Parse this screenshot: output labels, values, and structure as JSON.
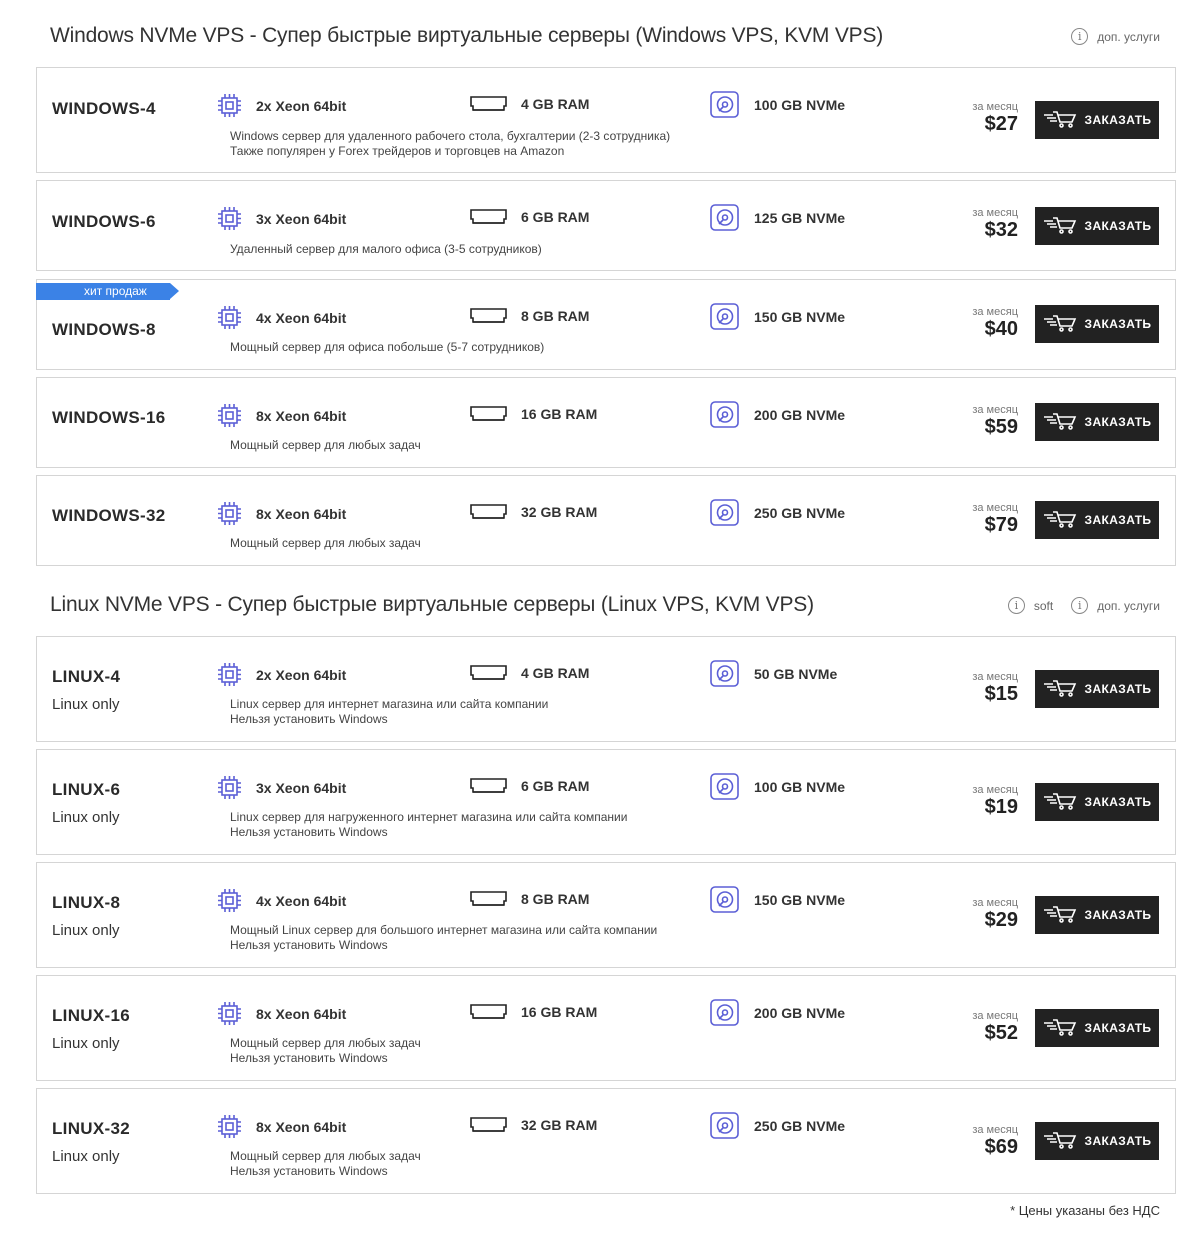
{
  "windows_section": {
    "title": "Windows NVMe VPS - Супер быстрые виртуальные серверы (Windows VPS, KVM VPS)",
    "extra_services": "доп. услуги"
  },
  "linux_section": {
    "title": "Linux NVMe VPS - Супер быстрые виртуальные серверы (Linux VPS, KVM VPS)",
    "soft": "soft",
    "extra_services": "доп. услуги"
  },
  "common": {
    "per_month": "за месяц",
    "order_label": "ЗАКАЗАТЬ",
    "bestseller": "хит продаж",
    "linux_only": "Linux only"
  },
  "colors": {
    "accent": "#5b5fd6",
    "button": "#222222",
    "badge": "#3b82e6",
    "border": "#d5d5d5"
  },
  "windows_plans": [
    {
      "name": "WINDOWS-4",
      "cpu": "2x Xeon 64bit",
      "ram": "4 GB RAM",
      "disk": "100 GB NVMe",
      "desc1": "Windows сервер для удаленного рабочего стола, бухгалтерии (2-3 сотрудника)",
      "desc2": "Также популярен у Forex трейдеров и торговцев на Amazon",
      "price": "$27"
    },
    {
      "name": "WINDOWS-6",
      "cpu": "3x Xeon 64bit",
      "ram": "6 GB RAM",
      "disk": "125 GB NVMe",
      "desc1": "Удаленный сервер для малого офиса (3-5 сотрудников)",
      "price": "$32"
    },
    {
      "name": "WINDOWS-8",
      "cpu": "4x Xeon 64bit",
      "ram": "8 GB RAM",
      "disk": "150 GB NVMe",
      "desc1": "Мощный сервер для офиса побольше (5-7 сотрудников)",
      "price": "$40"
    },
    {
      "name": "WINDOWS-16",
      "cpu": "8x Xeon 64bit",
      "ram": "16 GB RAM",
      "disk": "200 GB NVMe",
      "desc1": "Мощный сервер для любых задач",
      "price": "$59"
    },
    {
      "name": "WINDOWS-32",
      "cpu": "8x Xeon 64bit",
      "ram": "32 GB RAM",
      "disk": "250 GB NVMe",
      "desc1": "Мощный сервер для любых задач",
      "price": "$79"
    }
  ],
  "linux_plans": [
    {
      "name": "LINUX-4",
      "cpu": "2x Xeon 64bit",
      "ram": "4 GB RAM",
      "disk": "50 GB NVMe",
      "desc1": "Linux сервер для интернет магазина или сайта компании",
      "desc2": "Нельзя установить Windows",
      "price": "$15"
    },
    {
      "name": "LINUX-6",
      "cpu": "3x Xeon 64bit",
      "ram": "6 GB RAM",
      "disk": "100 GB NVMe",
      "desc1": "Linux сервер для нагруженного интернет магазина или сайта компании",
      "desc2": "Нельзя установить Windows",
      "price": "$19"
    },
    {
      "name": "LINUX-8",
      "cpu": "4x Xeon 64bit",
      "ram": "8 GB RAM",
      "disk": "150 GB NVMe",
      "desc1": "Мощный Linux сервер для большого интернет магазина или сайта компании",
      "desc2": "Нельзя установить Windows",
      "price": "$29"
    },
    {
      "name": "LINUX-16",
      "cpu": "8x Xeon 64bit",
      "ram": "16 GB RAM",
      "disk": "200 GB NVMe",
      "desc1": "Мощный сервер для любых задач",
      "desc2": "Нельзя установить Windows",
      "price": "$52"
    },
    {
      "name": "LINUX-32",
      "cpu": "8x Xeon 64bit",
      "ram": "32 GB RAM",
      "disk": "250 GB NVMe",
      "desc1": "Мощный сервер для любых задач",
      "desc2": "Нельзя установить Windows",
      "price": "$69"
    }
  ],
  "footnote": "* Цены указаны без НДС"
}
